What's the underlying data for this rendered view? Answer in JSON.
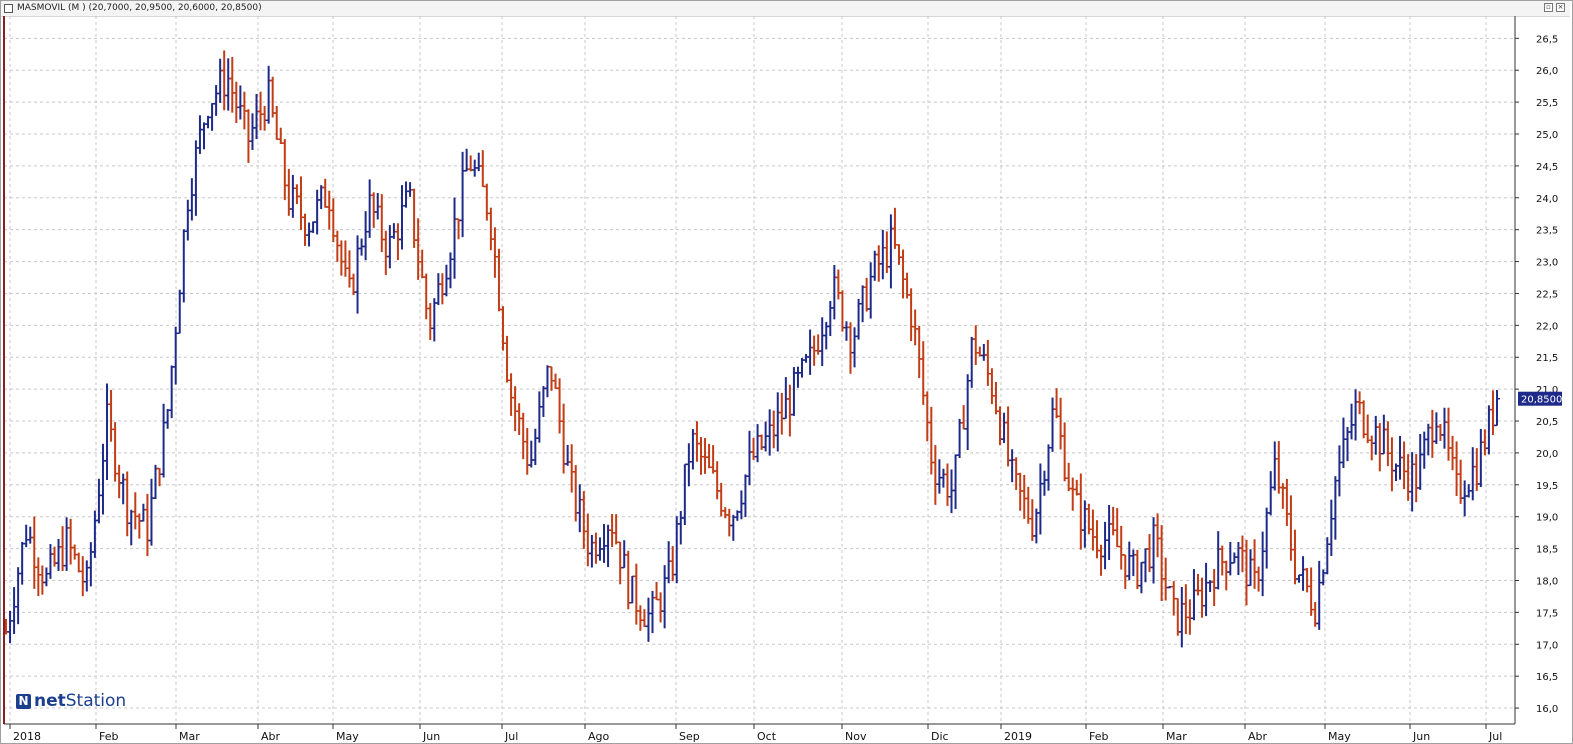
{
  "window": {
    "title": "MASMOVIL (M ) (20,7000, 20,9500, 20,6000, 20,8500)"
  },
  "logo": {
    "mark": "N",
    "part1": "net",
    "part2": "Station"
  },
  "colors": {
    "up": "#1e2a8a",
    "down": "#c23d15",
    "grid": "#c8c8c8",
    "price_badge": "#1e2a8a"
  },
  "chart_data": {
    "type": "ohlc",
    "title": "",
    "ylim": [
      15.75,
      26.85
    ],
    "y_ticks": [
      "16,0",
      "16,5",
      "17,0",
      "17,5",
      "18,0",
      "18,5",
      "19,0",
      "19,5",
      "20,0",
      "20,5",
      "21,0",
      "21,5",
      "22,0",
      "22,5",
      "23,0",
      "23,5",
      "24,0",
      "24,5",
      "25,0",
      "25,5",
      "26,0",
      "26,5"
    ],
    "x_labels": [
      "2018",
      "Feb",
      "Mar",
      "Abr",
      "May",
      "Jun",
      "Jul",
      "Ago",
      "Sep",
      "Oct",
      "Nov",
      "Dic",
      "2019",
      "Feb",
      "Mar",
      "Abr",
      "May",
      "Jun",
      "Jul"
    ],
    "grid": true,
    "last_price_label": "20,8500",
    "last_close": 20.85,
    "series": [
      {
        "close_path": [
          [
            "2018",
            17.2
          ],
          [
            "2018",
            18.8
          ],
          [
            "2018",
            18.0
          ],
          [
            "2018",
            18.6
          ],
          [
            "2018",
            17.9
          ],
          [
            "Feb",
            20.5
          ],
          [
            "Feb",
            19.2
          ],
          [
            "Feb",
            18.8
          ],
          [
            "Feb",
            20.6
          ],
          [
            "Mar",
            24.0
          ],
          [
            "Mar",
            25.5
          ],
          [
            "Mar",
            25.9
          ],
          [
            "Mar",
            24.9
          ],
          [
            "Mar",
            25.6
          ],
          [
            "Abr",
            24.0
          ],
          [
            "Abr",
            23.6
          ],
          [
            "Abr",
            24.1
          ],
          [
            "Abr",
            22.4
          ],
          [
            "May",
            23.9
          ],
          [
            "May",
            23.2
          ],
          [
            "May",
            24.0
          ],
          [
            "Jun",
            22.0
          ],
          [
            "Jun",
            23.2
          ],
          [
            "Jun",
            24.6
          ],
          [
            "Jun",
            23.8
          ],
          [
            "Jun",
            21.0
          ],
          [
            "Jul",
            19.8
          ],
          [
            "Jul",
            21.4
          ],
          [
            "Jul",
            19.5
          ],
          [
            "Jul",
            18.5
          ],
          [
            "Ago",
            19.0
          ],
          [
            "Ago",
            17.8
          ],
          [
            "Ago",
            17.4
          ],
          [
            "Ago",
            18.1
          ],
          [
            "Sep",
            20.2
          ],
          [
            "Sep",
            19.6
          ],
          [
            "Sep",
            19.0
          ],
          [
            "Sep",
            19.9
          ],
          [
            "Sep",
            20.3
          ],
          [
            "Oct",
            20.9
          ],
          [
            "Oct",
            21.5
          ],
          [
            "Oct",
            22.6
          ],
          [
            "Oct",
            21.8
          ],
          [
            "Oct",
            22.8
          ],
          [
            "Nov",
            23.3
          ],
          [
            "Nov",
            22.1
          ],
          [
            "Nov",
            19.8
          ],
          [
            "Nov",
            19.4
          ],
          [
            "Dic",
            21.8
          ],
          [
            "Dic",
            21.0
          ],
          [
            "Dic",
            19.5
          ],
          [
            "Dic",
            18.9
          ],
          [
            "2019",
            20.7
          ],
          [
            "2019",
            19.2
          ],
          [
            "2019",
            18.7
          ],
          [
            "Feb",
            18.6
          ],
          [
            "Feb",
            18.1
          ],
          [
            "Feb",
            18.6
          ],
          [
            "Mar",
            17.4
          ],
          [
            "Mar",
            17.6
          ],
          [
            "Mar",
            18.2
          ],
          [
            "Mar",
            18.5
          ],
          [
            "Mar",
            17.9
          ],
          [
            "Abr",
            19.8
          ],
          [
            "Abr",
            18.2
          ],
          [
            "Abr",
            17.6
          ],
          [
            "May",
            19.6
          ],
          [
            "May",
            20.7
          ],
          [
            "May",
            20.3
          ],
          [
            "May",
            19.8
          ],
          [
            "May",
            19.6
          ],
          [
            "Jun",
            20.7
          ],
          [
            "Jun",
            19.4
          ],
          [
            "Jun",
            19.8
          ],
          [
            "Jul",
            20.85
          ]
        ]
      }
    ]
  }
}
